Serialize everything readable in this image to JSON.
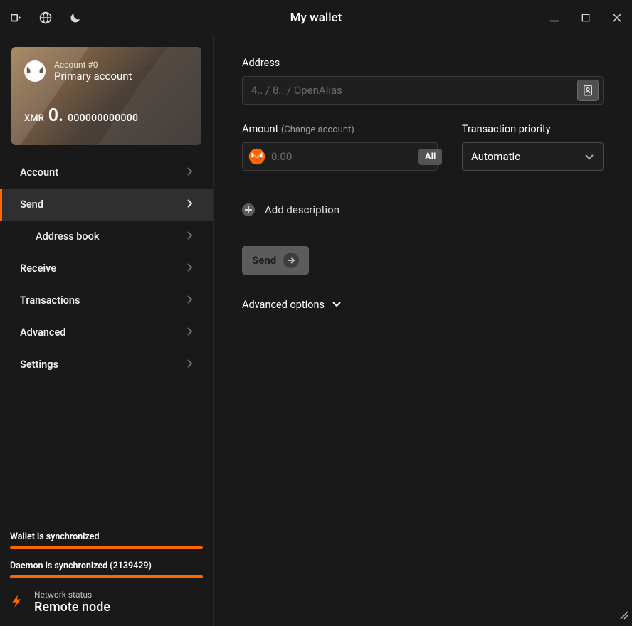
{
  "titlebar": {
    "title": "My wallet"
  },
  "account_card": {
    "account_line": "Account #0",
    "name": "Primary account",
    "currency": "XMR",
    "balance_int": "0.",
    "balance_dec": "000000000000"
  },
  "nav": {
    "account": "Account",
    "send": "Send",
    "address_book": "Address book",
    "receive": "Receive",
    "transactions": "Transactions",
    "advanced": "Advanced",
    "settings": "Settings"
  },
  "status": {
    "wallet_sync": "Wallet is synchronized",
    "daemon_sync": "Daemon is synchronized (2139429)",
    "network_label": "Network status",
    "network_value": "Remote node"
  },
  "form": {
    "address_label": "Address",
    "address_placeholder": "4.. / 8.. / OpenAlias",
    "amount_label": "Amount",
    "amount_sublabel": "(Change account)",
    "amount_placeholder": "0.00",
    "all_btn": "All",
    "priority_label": "Transaction priority",
    "priority_value": "Automatic",
    "add_description": "Add description",
    "send_btn": "Send",
    "advanced_options": "Advanced options"
  }
}
